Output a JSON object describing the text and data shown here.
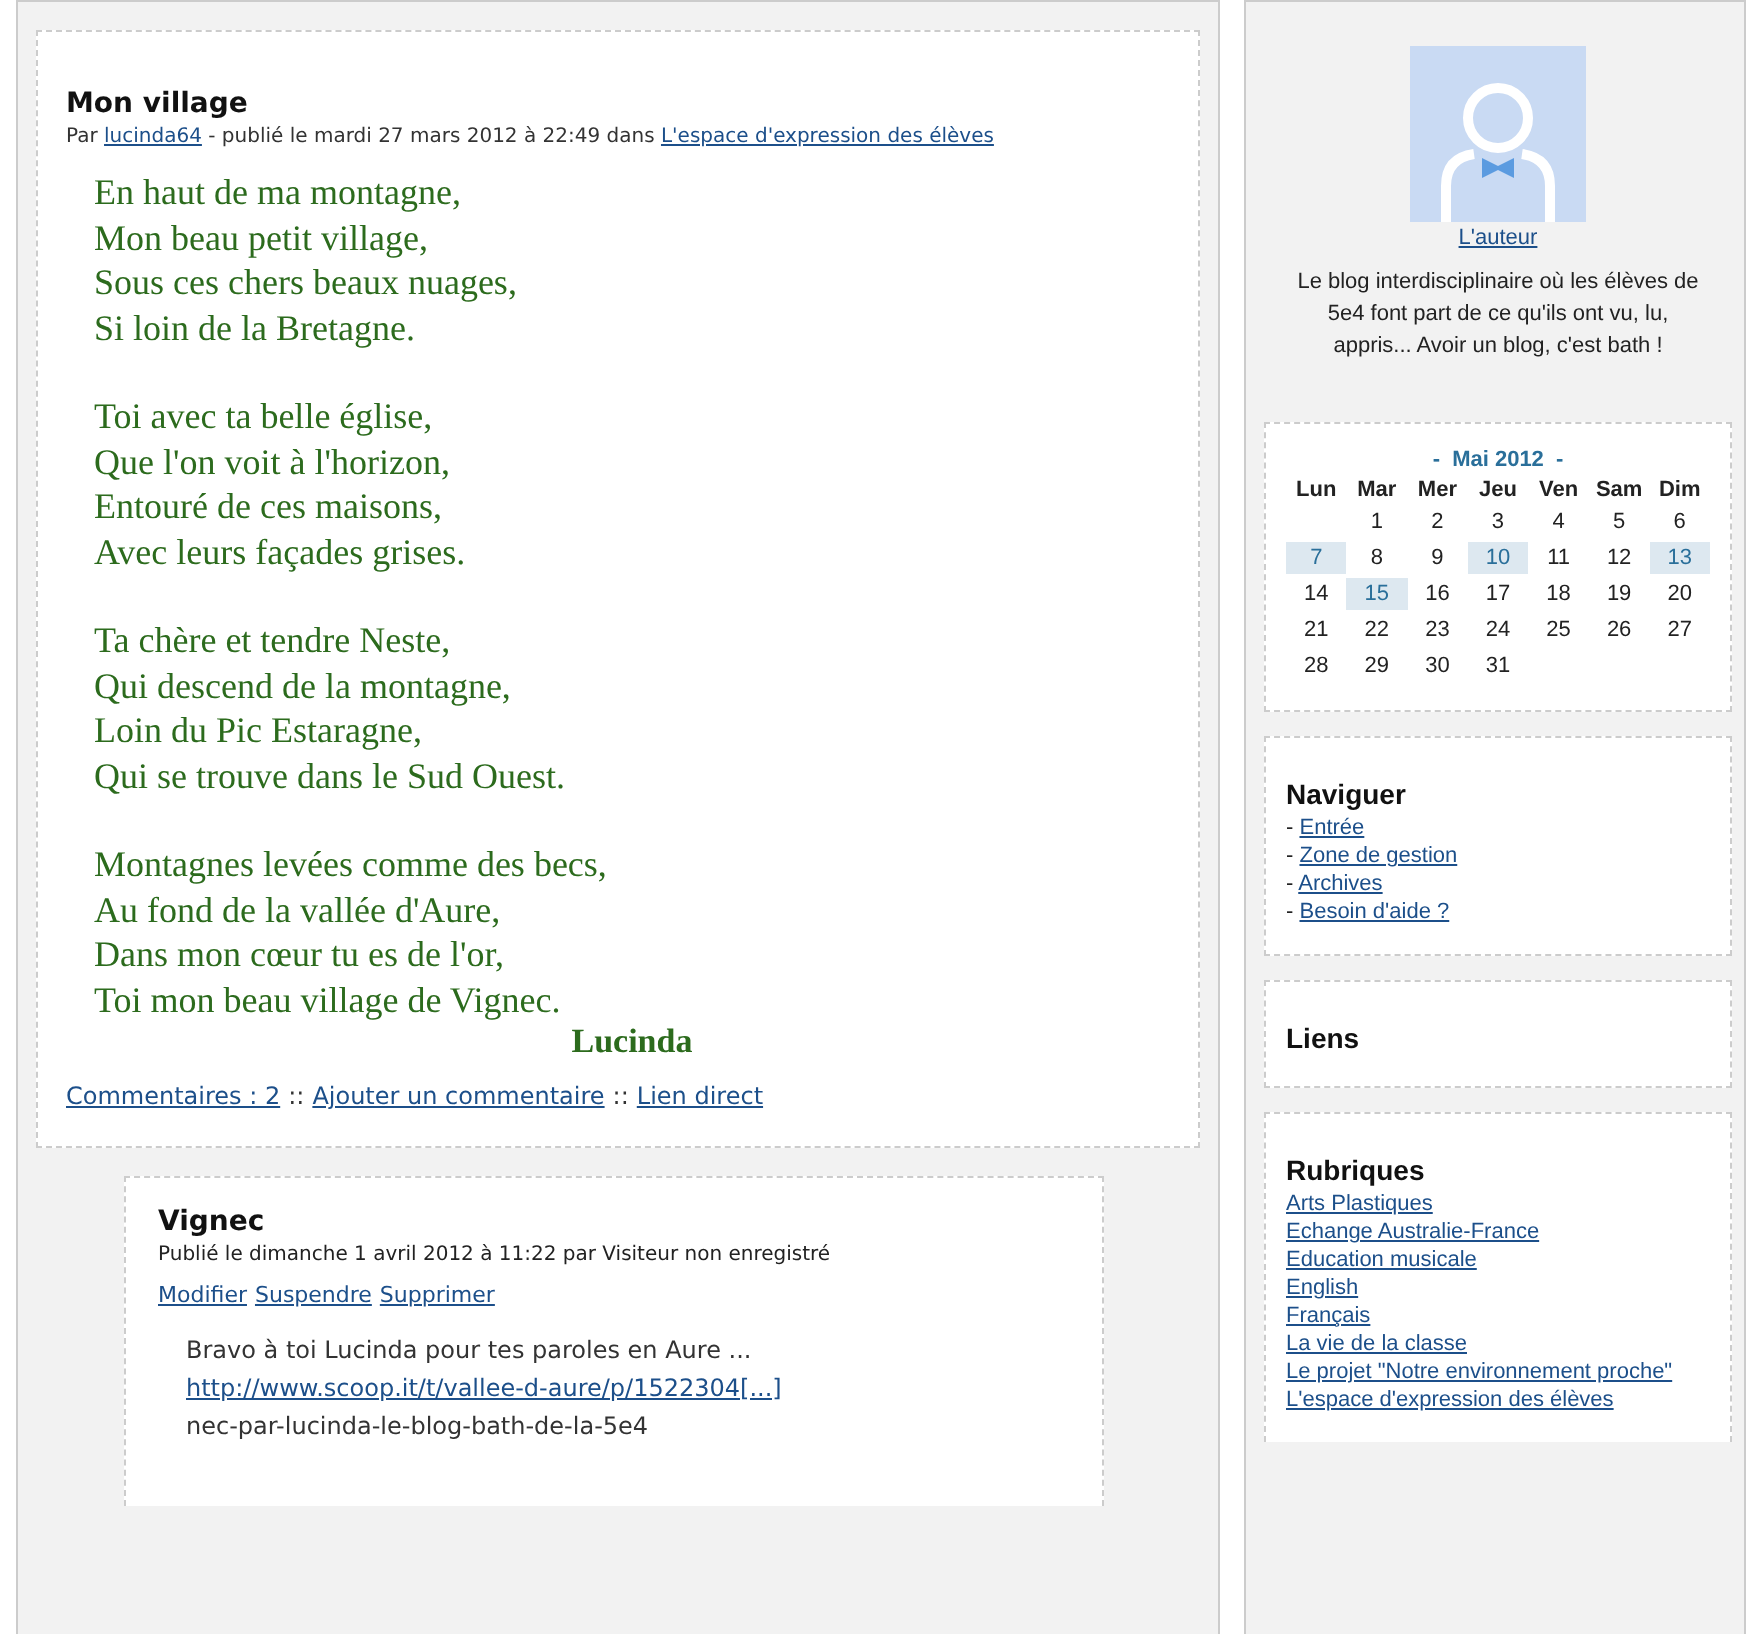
{
  "post": {
    "title": "Mon village",
    "meta": {
      "by": "Par",
      "author": "lucinda64",
      "published": "- publié le mardi 27 mars 2012 à 22:49 dans",
      "category": "L'espace d'expression des élèves"
    },
    "stanzas": [
      [
        "En haut de ma montagne,",
        "Mon beau petit village,",
        "Sous ces chers beaux nuages,",
        "Si loin de la Bretagne."
      ],
      [
        "Toi avec ta belle église,",
        "Que l'on voit à l'horizon,",
        "Entouré de ces maisons,",
        "Avec leurs façades grises."
      ],
      [
        "Ta chère et tendre Neste,",
        "Qui descend de la montagne,",
        "Loin du Pic Estaragne,",
        "Qui se trouve dans le Sud Ouest."
      ],
      [
        "Montagnes levées comme des becs,",
        "Au fond de la vallée d'Aure,",
        "Dans mon cœur tu es de l'or,",
        "Toi mon beau village de Vignec."
      ]
    ],
    "signature": "Lucinda",
    "footer": [
      {
        "kind": "link",
        "text": "Commentaires : 2"
      },
      {
        "kind": "sep",
        "text": "::"
      },
      {
        "kind": "link",
        "text": "Ajouter un commentaire"
      },
      {
        "kind": "sep",
        "text": "::"
      },
      {
        "kind": "link",
        "text": "Lien direct"
      }
    ]
  },
  "comment": {
    "title": "Vignec",
    "meta": "Publié le dimanche 1 avril 2012 à 11:22 par Visiteur non enregistré",
    "actions": [
      "Modifier",
      "Suspendre",
      "Supprimer"
    ],
    "body": [
      {
        "kind": "text",
        "text": "Bravo à toi Lucinda pour tes paroles en Aure ..."
      },
      {
        "kind": "link",
        "text": "http://www.scoop.it/t/vallee-d-aure/p/1522304[...]"
      },
      {
        "kind": "text",
        "text": "nec-par-lucinda-le-blog-bath-de-la-5e4"
      }
    ]
  },
  "sidebar": {
    "author_link": "L'auteur",
    "description": "Le blog interdisciplinaire où les élèves de 5e4 font part de ce qu'ils ont vu, lu, appris... Avoir un blog, c'est bath !",
    "calendar": {
      "prev": "-",
      "month": "Mai 2012",
      "next": "-",
      "weekdays": [
        "Lun",
        "Mar",
        "Mer",
        "Jeu",
        "Ven",
        "Sam",
        "Dim"
      ],
      "weeks": [
        {
          "days": [
            {
              "kind": "blank"
            },
            {
              "kind": "day",
              "day": "1",
              "highlighted": false
            },
            {
              "day": "2",
              "highlighted": false
            },
            {
              "day": "3",
              "highlighted": false
            },
            {
              "day": "4",
              "highlighted": false
            },
            {
              "day": "5",
              "highlighted": false
            },
            {
              "day": "6",
              "highlighted": false
            }
          ]
        },
        {
          "days": [
            {
              "day": "7",
              "highlighted": true
            },
            {
              "day": "8",
              "highlighted": false
            },
            {
              "day": "9",
              "highlighted": false
            },
            {
              "day": "10",
              "highlighted": true
            },
            {
              "day": "11",
              "highlighted": false
            },
            {
              "day": "12",
              "highlighted": false
            },
            {
              "day": "13",
              "highlighted": true
            }
          ]
        },
        {
          "days": [
            {
              "day": "14",
              "highlighted": false
            },
            {
              "day": "15",
              "highlighted": true
            },
            {
              "day": "16",
              "highlighted": false
            },
            {
              "day": "17",
              "highlighted": false
            },
            {
              "day": "18",
              "highlighted": false
            },
            {
              "day": "19",
              "highlighted": false
            },
            {
              "day": "20",
              "highlighted": false
            }
          ]
        },
        {
          "days": [
            {
              "day": "21",
              "highlighted": false
            },
            {
              "day": "22",
              "highlighted": false
            },
            {
              "day": "23",
              "highlighted": false
            },
            {
              "day": "24",
              "highlighted": false
            },
            {
              "day": "25",
              "highlighted": false
            },
            {
              "day": "26",
              "highlighted": false
            },
            {
              "day": "27",
              "highlighted": false
            }
          ]
        },
        {
          "days": [
            {
              "day": "28",
              "highlighted": false
            },
            {
              "day": "29",
              "highlighted": false
            },
            {
              "day": "30",
              "highlighted": false
            },
            {
              "day": "31",
              "highlighted": false
            }
          ]
        }
      ]
    },
    "navigation": {
      "title": "Naviguer",
      "bullet": "-",
      "items": [
        "Entrée",
        "Zone de gestion",
        "Archives",
        "Besoin d'aide ?"
      ]
    },
    "links": {
      "title": "Liens"
    },
    "categories": {
      "title": "Rubriques",
      "items": [
        "Arts Plastiques",
        "Echange Australie-France",
        "Education musicale",
        "English",
        "Français",
        "La vie de la classe",
        "Le projet \"Notre environnement proche\"",
        "L'espace d'expression des élèves"
      ]
    }
  }
}
